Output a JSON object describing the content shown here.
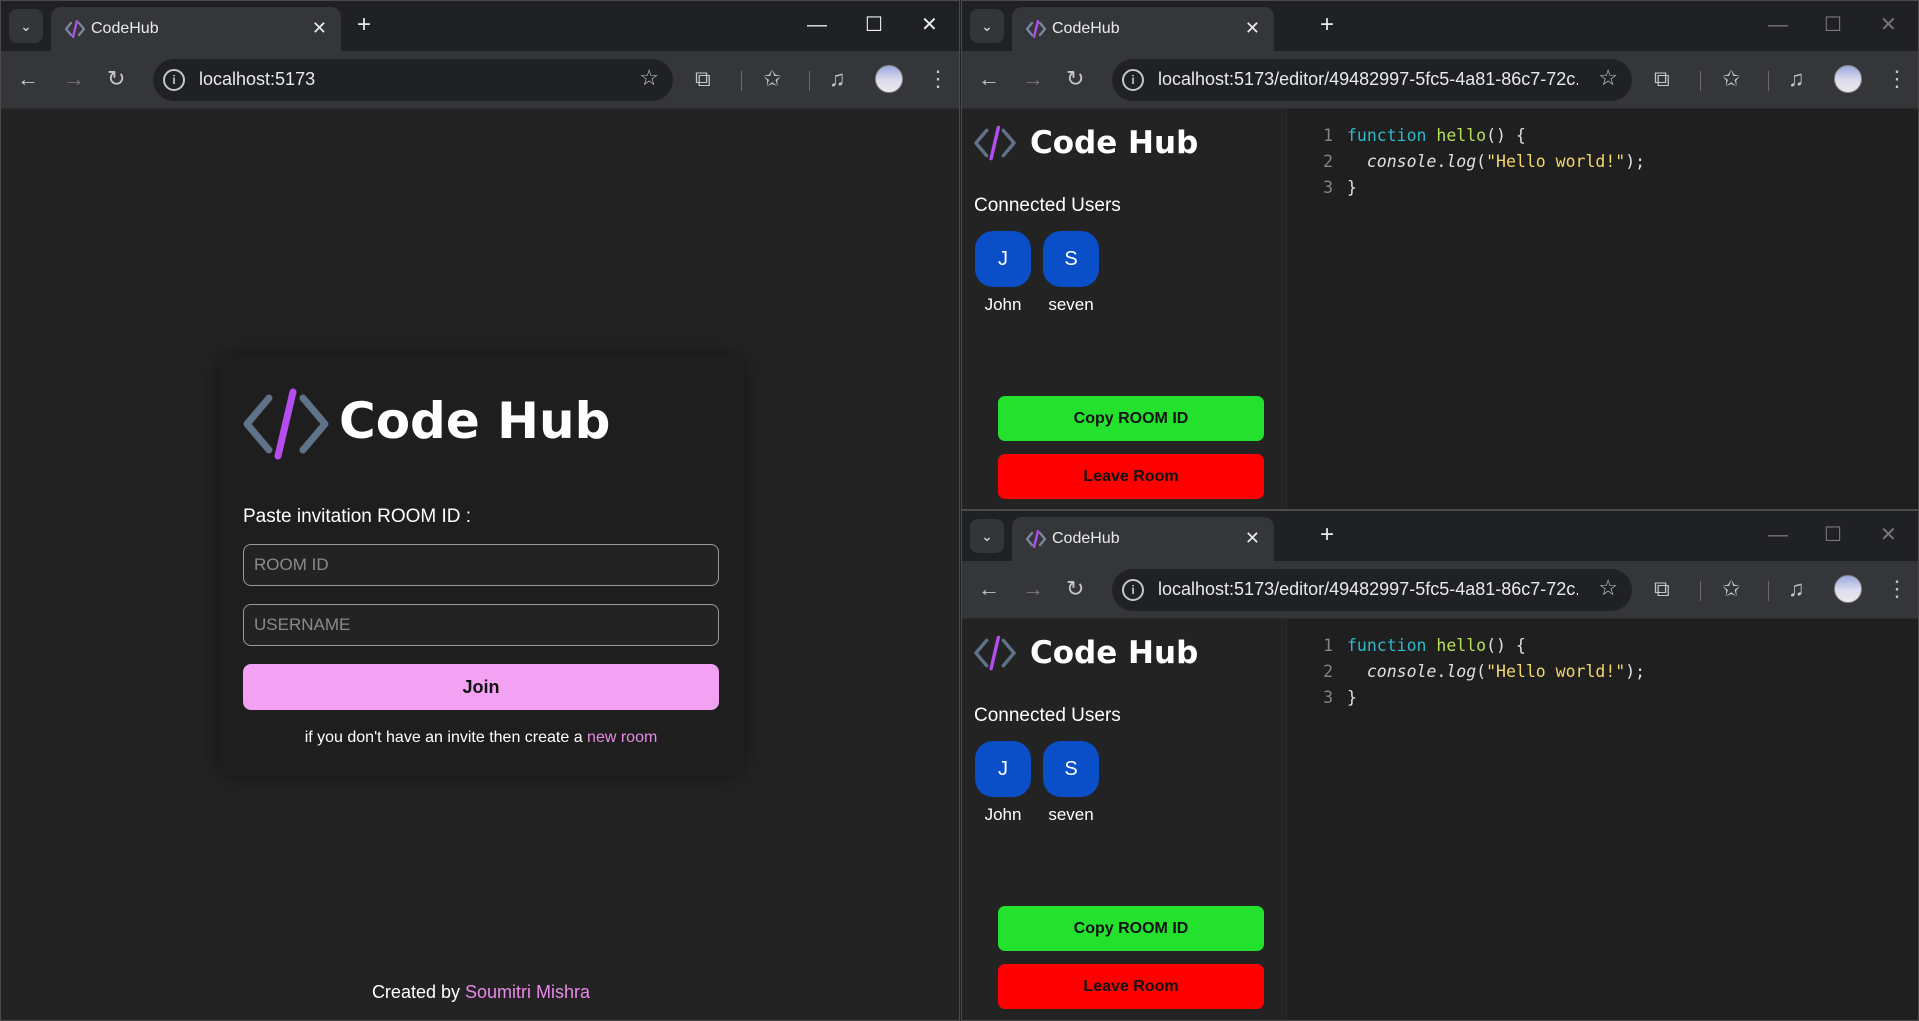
{
  "login_window": {
    "tab_title": "CodeHub",
    "url": "localhost:5173",
    "logo_text": "Code Hub",
    "room_label": "Paste invitation ROOM ID :",
    "room_placeholder": "ROOM ID",
    "username_placeholder": "USERNAME",
    "join_label": "Join",
    "invite_text": "if you don't have an invite then create a",
    "new_room_link": "new room",
    "footer_prefix": "Created by",
    "footer_author": "Soumitri Mishra"
  },
  "editor_windows": [
    {
      "tab_title": "CodeHub",
      "url": "localhost:5173/editor/49482997-5fc5-4a81-86c7-72c...",
      "logo_text": "Code Hub",
      "connected_label": "Connected Users",
      "users": [
        {
          "initial": "J",
          "name": "John"
        },
        {
          "initial": "S",
          "name": "seven"
        }
      ],
      "copy_label": "Copy ROOM ID",
      "leave_label": "Leave Room",
      "code": {
        "kw": "function",
        "fn": "hello",
        "paren": "() {",
        "console": "console",
        "dot": ".",
        "log": "log",
        "open": "(",
        "str": "\"Hello world!\"",
        "close": ");",
        "brace": "}"
      },
      "line_numbers": [
        "1",
        "2",
        "3"
      ]
    },
    {
      "tab_title": "CodeHub",
      "url": "localhost:5173/editor/49482997-5fc5-4a81-86c7-72c...",
      "logo_text": "Code Hub",
      "connected_label": "Connected Users",
      "users": [
        {
          "initial": "J",
          "name": "John"
        },
        {
          "initial": "S",
          "name": "seven"
        }
      ],
      "copy_label": "Copy ROOM ID",
      "leave_label": "Leave Room",
      "code": {
        "kw": "function",
        "fn": "hello",
        "paren": "() {",
        "console": "console",
        "dot": ".",
        "log": "log",
        "open": "(",
        "str": "\"Hello world!\"",
        "close": ");",
        "brace": "}"
      },
      "line_numbers": [
        "1",
        "2",
        "3"
      ]
    }
  ],
  "colors": {
    "accent_pink": "#f3a2f3",
    "link_pink": "#e88ae8",
    "copy_green": "#23e12d",
    "leave_red": "#ff0000",
    "user_blue": "#0a4fc7"
  },
  "icons": [
    "tab-search-icon",
    "codehub-favicon",
    "close-icon",
    "new-tab-icon",
    "minimize-icon",
    "maximize-icon",
    "back-icon",
    "forward-icon",
    "reload-icon",
    "site-info-icon",
    "bookmark-star-icon",
    "extensions-icon",
    "favorites-icon",
    "media-control-icon",
    "profile-avatar",
    "kebab-menu-icon"
  ]
}
